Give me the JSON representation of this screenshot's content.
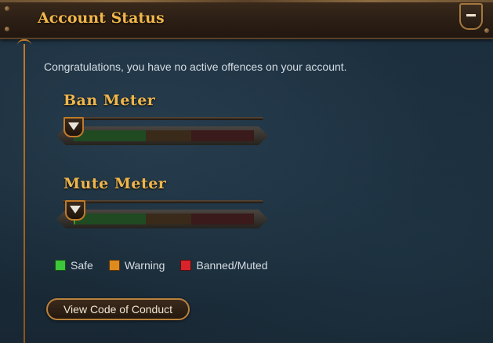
{
  "header": {
    "title": "Account Status",
    "collapse_icon": "minus-icon"
  },
  "intro_text": "Congratulations, you have no active offences on your account.",
  "meters": [
    {
      "label": "Ban Meter",
      "level_percent": 0
    },
    {
      "label": "Mute Meter",
      "level_percent": 1
    }
  ],
  "legend": [
    {
      "label": "Safe",
      "color": "#3cc83a"
    },
    {
      "label": "Warning",
      "color": "#e08a1e"
    },
    {
      "label": "Banned/Muted",
      "color": "#d8232a"
    }
  ],
  "meter_colors": {
    "safe": "#1f4a22",
    "warning": "#3a2a1a",
    "banned": "#3a1a1a"
  },
  "conduct_button": {
    "label": "View Code of Conduct"
  }
}
